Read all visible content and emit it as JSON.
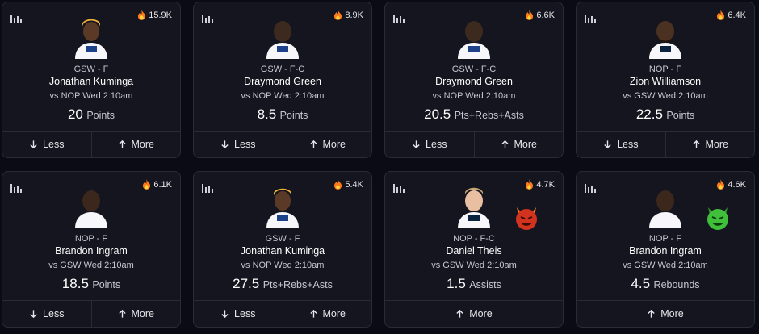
{
  "colors": {
    "background": "#0b0b16",
    "card": "#15151f",
    "border": "#2b2b36",
    "flame": "#ff7a1a",
    "demon_red": "#d2331f",
    "demon_green": "#3fbf3a"
  },
  "icons": {
    "stats": "bar-chart-icon",
    "popularity": "flame-icon",
    "less": "arrow-down-icon",
    "more": "arrow-up-icon"
  },
  "cards": [
    {
      "popularity": "15.9K",
      "team_pos": "GSW - F",
      "name": "Jonathan Kuminga",
      "matchup": "vs NOP Wed 2:10am",
      "line": "20",
      "stat": "Points",
      "less": "Less",
      "more": "More"
    },
    {
      "popularity": "8.9K",
      "team_pos": "GSW - F-C",
      "name": "Draymond Green",
      "matchup": "vs NOP Wed 2:10am",
      "line": "8.5",
      "stat": "Points",
      "less": "Less",
      "more": "More"
    },
    {
      "popularity": "6.6K",
      "team_pos": "GSW - F-C",
      "name": "Draymond Green",
      "matchup": "vs NOP Wed 2:10am",
      "line": "20.5",
      "stat": "Pts+Rebs+Asts",
      "less": "Less",
      "more": "More"
    },
    {
      "popularity": "6.4K",
      "team_pos": "NOP - F",
      "name": "Zion Williamson",
      "matchup": "vs GSW Wed 2:10am",
      "line": "22.5",
      "stat": "Points",
      "less": "Less",
      "more": "More"
    },
    {
      "popularity": "6.1K",
      "team_pos": "NOP - F",
      "name": "Brandon Ingram",
      "matchup": "vs GSW Wed 2:10am",
      "line": "18.5",
      "stat": "Points",
      "less": "Less",
      "more": "More"
    },
    {
      "popularity": "5.4K",
      "team_pos": "GSW - F",
      "name": "Jonathan Kuminga",
      "matchup": "vs NOP Wed 2:10am",
      "line": "27.5",
      "stat": "Pts+Rebs+Asts",
      "less": "Less",
      "more": "More"
    },
    {
      "popularity": "4.7K",
      "team_pos": "NOP - F-C",
      "name": "Daniel Theis",
      "matchup": "vs GSW Wed 2:10am",
      "line": "1.5",
      "stat": "Assists",
      "more": "More",
      "badge": "red-demon"
    },
    {
      "popularity": "4.6K",
      "team_pos": "NOP - F",
      "name": "Brandon Ingram",
      "matchup": "vs GSW Wed 2:10am",
      "line": "4.5",
      "stat": "Rebounds",
      "more": "More",
      "badge": "green-demon"
    }
  ]
}
